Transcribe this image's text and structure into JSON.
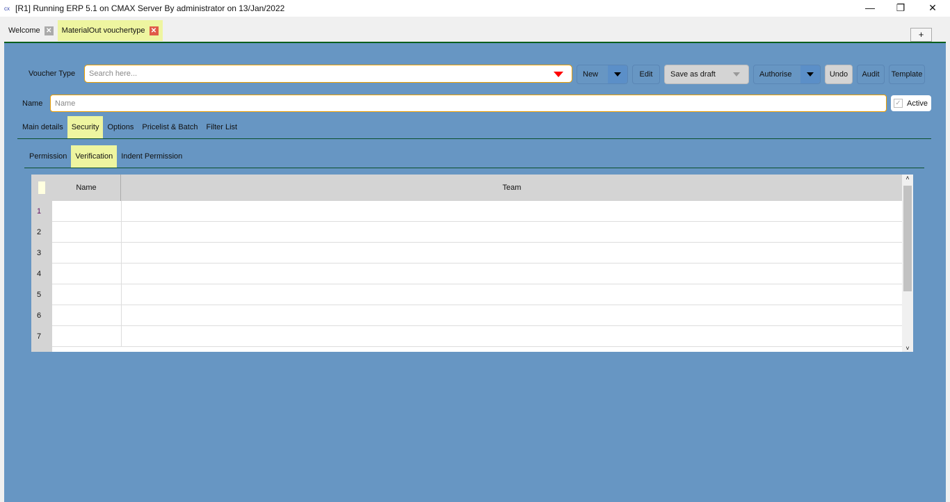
{
  "window": {
    "title": "[R1] Running ERP 5.1 on CMAX Server By administrator on 13/Jan/2022",
    "logo": "cx",
    "minimize": "—",
    "restore": "❐",
    "close": "✕"
  },
  "tabs": [
    {
      "label": "Welcome"
    },
    {
      "label": "MaterialOut vouchertype"
    }
  ],
  "add_tab": "+",
  "toolbar": {
    "voucher_type_label": "Voucher Type",
    "search_placeholder": "Search here...",
    "new": "New",
    "edit": "Edit",
    "save_draft": "Save as draft",
    "authorise": "Authorise",
    "undo": "Undo",
    "audit": "Audit",
    "template": "Template"
  },
  "name_field": {
    "label": "Name",
    "placeholder": "Name"
  },
  "active": {
    "label": "Active",
    "checked": true
  },
  "main_tabs": [
    "Main details",
    "Security",
    "Options",
    "Pricelist & Batch",
    "Filter List"
  ],
  "main_tab_active": "Security",
  "sub_tabs": [
    "Permission",
    "Verification",
    "Indent Permission"
  ],
  "sub_tab_active": "Verification",
  "grid": {
    "columns": [
      "Name",
      "Team"
    ],
    "rows": [
      "1",
      "2",
      "3",
      "4",
      "5",
      "6",
      "7"
    ]
  },
  "colors": {
    "background": "#6796c3",
    "active_tab": "#eef5a0",
    "input_border": "#f0a000"
  }
}
